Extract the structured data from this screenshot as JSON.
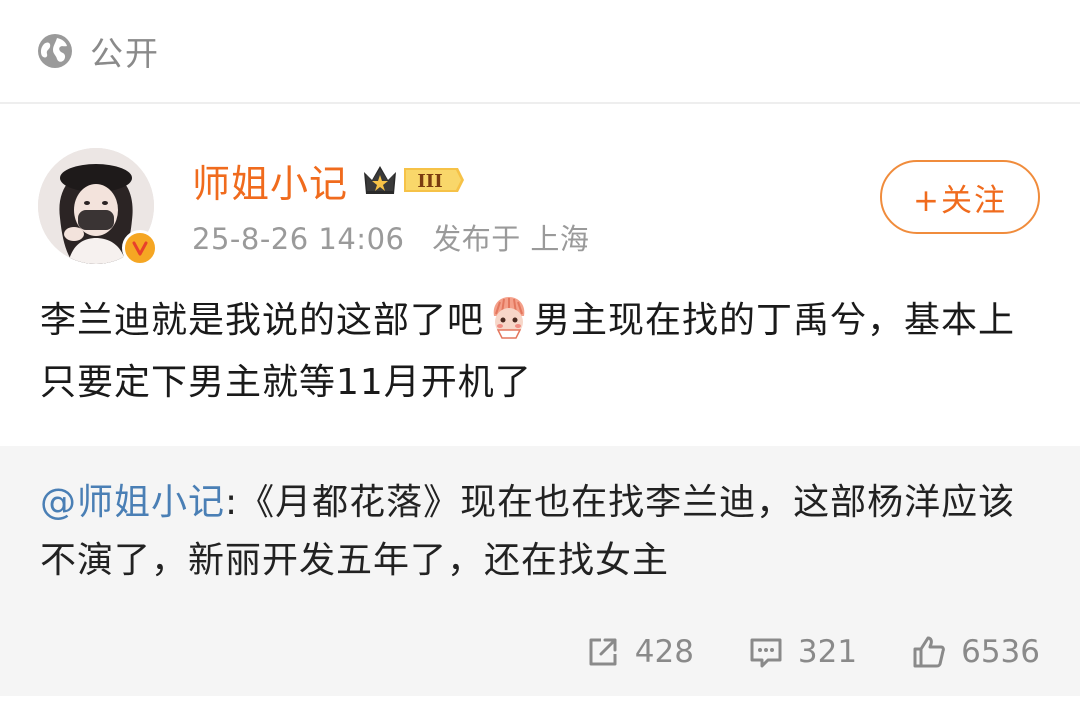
{
  "visibility": {
    "label": "公开",
    "icon": "globe-icon"
  },
  "author": {
    "name": "师姐小记",
    "vip_badge": "III",
    "verified": true
  },
  "meta": {
    "timestamp": "25-8-26 14:06",
    "location": "发布于 上海"
  },
  "follow_button": {
    "label": "+关注"
  },
  "post": {
    "text_part1": "李兰迪就是我说的这部了吧",
    "text_part2": "男主现在找的丁禹兮，基本上只要定下男主就等11月开机了",
    "emoji": "fan-face-emoji"
  },
  "repost": {
    "mention": "@师姐小记",
    "text": ":《月都花落》现在也在找李兰迪，这部杨洋应该不演了，新丽开发五年了，还在找女主"
  },
  "actions": {
    "share_count": "428",
    "comment_count": "321",
    "like_count": "6536"
  },
  "colors": {
    "accent": "#f06b1d",
    "mention": "#4a7fb5",
    "muted": "#8a8a8a",
    "repost_bg": "#f5f5f5"
  }
}
